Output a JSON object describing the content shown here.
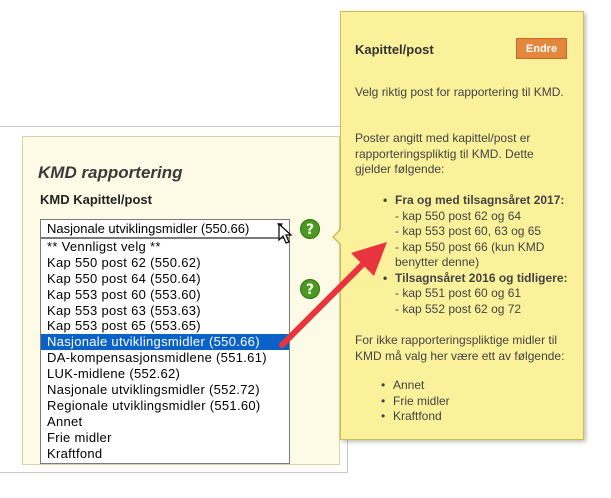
{
  "kmd": {
    "title": "KMD rapportering",
    "field_label": "KMD Kapittel/post",
    "selected_value": "Nasjonale utviklingsmidler (550.66)",
    "options": [
      "** Vennligst velg **",
      "Kap 550 post 62 (550.62)",
      "Kap 550 post 64 (550.64)",
      "Kap 553 post 60 (553.60)",
      "Kap 553 post 63 (553.63)",
      "Kap 553 post 65 (553.65)",
      "Nasjonale utviklingsmidler (550.66)",
      "DA-kompensasjonsmidlene (551.61)",
      "LUK-midlene (552.62)",
      "Nasjonale utviklingsmidler (552.72)",
      "Regionale utviklingsmidler (551.60)",
      "Annet",
      "Frie midler",
      "Kraftfond"
    ],
    "selected_index": 6,
    "help_icon": "?"
  },
  "tooltip": {
    "title": "Kapittel/post",
    "edit_label": "Endre",
    "para1": "Velg riktig post for rapportering til KMD.",
    "para2": "Poster angitt med kapittel/post er rapporteringspliktig til KMD. Dette gjelder følgende:",
    "group1_head": "Fra og med tilsagnsåret 2017:",
    "group1_items": [
      "- kap 550 post 62 og 64",
      "- kap 553 post 60, 63 og 65",
      "- kap 550 post 66 (kun KMD benytter denne)"
    ],
    "group2_head": "Tilsagnsåret 2016 og tidligere:",
    "group2_items": [
      "- kap 551 post 60 og 61",
      "- kap 552 post 62 og 72"
    ],
    "para3": "For ikke rapporteringspliktige midler til KMD må valg her være ett av følgende:",
    "other_items": [
      "Annet",
      "Frie midler",
      "Kraftfond"
    ]
  },
  "colors": {
    "selected_bg": "#0a62c9",
    "tooltip_bg": "#fbf19a",
    "edit_button": "#e2873c",
    "help_icon": "#4a9a1f",
    "arrow": "#e8343c"
  }
}
